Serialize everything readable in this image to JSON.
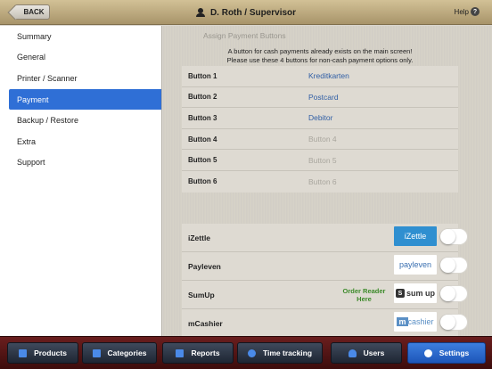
{
  "header": {
    "back_label": "BACK",
    "title": "D. Roth / Supervisor",
    "help_label": "Help",
    "help_icon": "?"
  },
  "sidebar": {
    "items": [
      {
        "label": "Summary"
      },
      {
        "label": "General"
      },
      {
        "label": "Printer / Scanner"
      },
      {
        "label": "Payment",
        "active": true
      },
      {
        "label": "Backup / Restore"
      },
      {
        "label": "Extra"
      },
      {
        "label": "Support"
      }
    ]
  },
  "payment": {
    "section_title": "Assign Payment Buttons",
    "info_line1": "A button for cash payments already exists on the main screen!",
    "info_line2": "Please use these 4 buttons for non-cash payment options only.",
    "buttons": [
      {
        "label": "Button 1",
        "value": "Kreditkarten",
        "placeholder": false
      },
      {
        "label": "Button 2",
        "value": "Postcard",
        "placeholder": false
      },
      {
        "label": "Button 3",
        "value": "Debitor",
        "placeholder": false
      },
      {
        "label": "Button 4",
        "value": "Button 4",
        "placeholder": true
      },
      {
        "label": "Button 5",
        "value": "Button 5",
        "placeholder": true
      },
      {
        "label": "Button 6",
        "value": "Button 6",
        "placeholder": true
      }
    ],
    "providers": [
      {
        "label": "iZettle",
        "logo_text": "iZettle"
      },
      {
        "label": "Payleven",
        "logo_text": "payleven"
      },
      {
        "label": "SumUp",
        "logo_text": "sum up",
        "order_line1": "Order Reader",
        "order_line2": "Here"
      },
      {
        "label": "mCashier",
        "logo_text": "cashier",
        "logo_mark": "m"
      }
    ]
  },
  "tabbar": {
    "tabs": [
      {
        "label": "Products"
      },
      {
        "label": "Categories"
      },
      {
        "label": "Reports"
      },
      {
        "label": "Time tracking"
      },
      {
        "label": "Users"
      },
      {
        "label": "Settings",
        "active": true
      }
    ]
  },
  "colors": {
    "accent": "#2f6fd6",
    "link": "#2f5ea5",
    "order_link": "#3c8a2a",
    "tabbar": "#5a1616"
  }
}
